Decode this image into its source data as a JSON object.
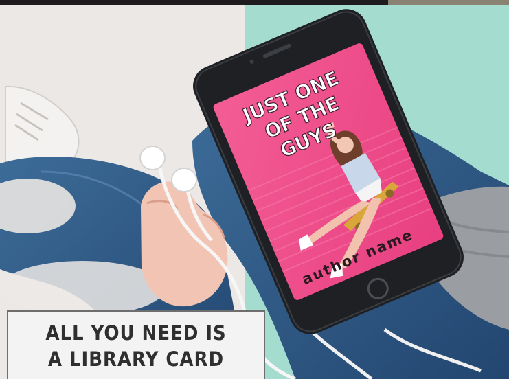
{
  "promo_image": {
    "caption": "ALL YOU NEED IS A LIBRARY CARD"
  },
  "ebook_cover": {
    "title": "JUST ONE OF THE GUYS",
    "author": "author name"
  },
  "colors": {
    "background_left": "#ebe8e6",
    "background_right": "#a4dcd0",
    "cover_pink": "#ef4f8b",
    "phone_body": "#1e2023",
    "jeans_blue": "#2f5a86",
    "caption_text": "#2f2f2f"
  }
}
